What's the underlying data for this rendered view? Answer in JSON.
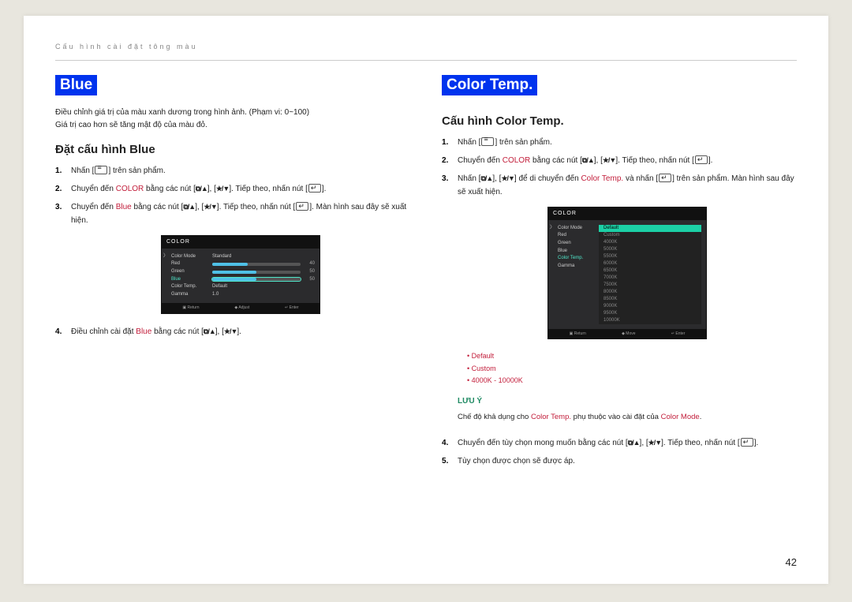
{
  "breadcrumb": "Cấu hình cài đặt tông màu",
  "page_number": "42",
  "left": {
    "title": "Blue",
    "desc1": "Điều chỉnh giá trị của màu xanh dương trong hình ảnh. (Phạm vi: 0~100)",
    "desc2": "Giá trị cao hơn sẽ tăng mật độ của màu đỏ.",
    "subheading": "Đặt cấu hình Blue",
    "step1a": "Nhấn [",
    "step1b": "] trên sản phẩm.",
    "step2a": "Chuyển đến ",
    "step2_color": "COLOR",
    "step2b": " bằng các nút [",
    "step2c": "]. Tiếp theo, nhấn nút [",
    "step2d": "].",
    "step3a": "Chuyển đến ",
    "step3_blue": "Blue",
    "step3b": " bằng các nút [",
    "step3c": "]. Tiếp theo, nhấn nút [",
    "step3d": "]. Màn hình sau đây sẽ xuất hiện.",
    "step4a": "Điều chỉnh cài đặt ",
    "step4_blue": "Blue",
    "step4b": " bằng các nút [",
    "step4c": "].",
    "osd": {
      "header": "COLOR",
      "color_mode_label": "Color Mode",
      "color_mode_value": "Standard",
      "red_label": "Red",
      "red_value": "40",
      "green_label": "Green",
      "green_value": "50",
      "blue_label": "Blue",
      "blue_value": "50",
      "color_temp_label": "Color Temp.",
      "color_temp_value": "Default",
      "gamma_label": "Gamma",
      "gamma_value": "1.0",
      "footer_return": "Return",
      "footer_adjust": "Adjust",
      "footer_enter": "Enter"
    }
  },
  "right": {
    "title": "Color Temp.",
    "subheading": "Cấu hình Color Temp.",
    "step1a": "Nhấn [",
    "step1b": "] trên sản phẩm.",
    "step2a": "Chuyển đến ",
    "step2_color": "COLOR",
    "step2b": " bằng các nút [",
    "step2c": "]. Tiếp theo, nhấn nút [",
    "step2d": "].",
    "step3a": "Nhấn [",
    "step3b": "] để di chuyển đến ",
    "step3_ct": "Color Temp.",
    "step3c": " và nhấn [",
    "step3d": "] trên sản phẩm. Màn hình sau đây sẽ xuất hiện.",
    "osd": {
      "header": "COLOR",
      "color_mode_label": "Color Mode",
      "red_label": "Red",
      "green_label": "Green",
      "blue_label": "Blue",
      "color_temp_label": "Color Temp.",
      "gamma_label": "Gamma",
      "list": [
        "Default",
        "Custom",
        "4000K",
        "5000K",
        "5500K",
        "6000K",
        "6500K",
        "7000K",
        "7500K",
        "8000K",
        "8500K",
        "9000K",
        "9500K",
        "10000K"
      ],
      "footer_return": "Return",
      "footer_move": "Move",
      "footer_enter": "Enter"
    },
    "bullets": {
      "b1": "Default",
      "b2": "Custom",
      "b3": "4000K - 10000K"
    },
    "note_label": "LƯU Ý",
    "note_a": "Chế độ khả dụng cho ",
    "note_ct": "Color Temp.",
    "note_b": " phụ thuộc vào cài đặt của ",
    "note_cm": "Color Mode",
    "note_c": ".",
    "step4a": "Chuyển đến tùy chọn mong muốn bằng các nút [",
    "step4b": "]. Tiếp theo, nhấn nút [",
    "step4c": "].",
    "step5": "Tùy chọn được chọn sẽ được áp."
  }
}
